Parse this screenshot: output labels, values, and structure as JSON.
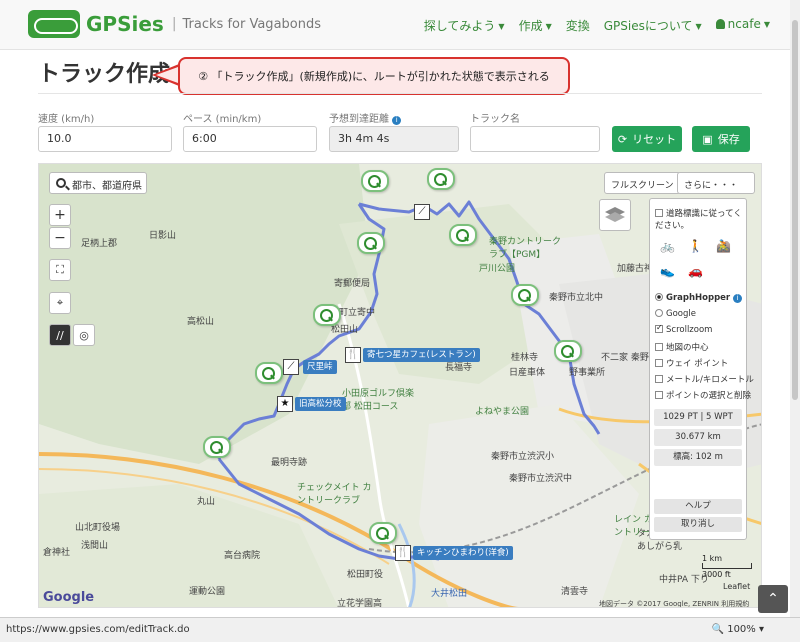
{
  "header": {
    "brand": "GPSies",
    "tagline": "Tracks for Vagabonds",
    "nav": [
      {
        "label": "探してみよう",
        "dropdown": true
      },
      {
        "label": "作成",
        "dropdown": true
      },
      {
        "label": "変換",
        "dropdown": false
      },
      {
        "label": "GPSiesについて",
        "dropdown": true
      },
      {
        "label": "ncafe",
        "dropdown": true
      }
    ]
  },
  "page": {
    "title": "トラック作成",
    "callout": "② 「トラック作成」(新規作成)に、ルートが引かれた状態で表示される"
  },
  "form": {
    "speed_label": "速度 (km/h)",
    "speed_value": "10.0",
    "pace_label": "ペース (min/km)",
    "pace_value": "6:00",
    "eta_label": "予想到達距離",
    "eta_value": "3h 4m 4s",
    "name_label": "トラック名",
    "name_value": "",
    "reset_label": "リセット",
    "save_label": "保存"
  },
  "map": {
    "search_placeholder": "都市、都道府県",
    "fullscreen": "フルスクリーン",
    "more": "さらに・・・",
    "zoom_in": "+",
    "zoom_out": "−",
    "labels": [
      {
        "text": "足柄上郡",
        "cls": ""
      },
      {
        "text": "日影山",
        "cls": ""
      },
      {
        "text": "寄郵便局",
        "cls": ""
      },
      {
        "text": "高松山",
        "cls": ""
      },
      {
        "text": "秦野カントリークラブ【PGM】",
        "cls": "green"
      },
      {
        "text": "戸川公園",
        "cls": "green"
      },
      {
        "text": "加藤古神社",
        "cls": ""
      },
      {
        "text": "秦野市立北中",
        "cls": ""
      },
      {
        "text": "桂林寺",
        "cls": ""
      },
      {
        "text": "不二家 秦野",
        "cls": ""
      },
      {
        "text": "日産車体",
        "cls": ""
      },
      {
        "text": "野事業所",
        "cls": ""
      },
      {
        "text": "小田原ゴルフ倶楽部 松田コース",
        "cls": "green"
      },
      {
        "text": "よねやま公園",
        "cls": "green"
      },
      {
        "text": "秦野市立渋沢小",
        "cls": ""
      },
      {
        "text": "秦野市立渋沢中",
        "cls": ""
      },
      {
        "text": "最明寺跡",
        "cls": ""
      },
      {
        "text": "チェックメイト カントリークラブ",
        "cls": "green"
      },
      {
        "text": "山北町役場",
        "cls": ""
      },
      {
        "text": "浅間山",
        "cls": ""
      },
      {
        "text": "丸山",
        "cls": ""
      },
      {
        "text": "倉神社",
        "cls": ""
      },
      {
        "text": "高台病院",
        "cls": ""
      },
      {
        "text": "運動公園",
        "cls": ""
      },
      {
        "text": "松田町役",
        "cls": ""
      },
      {
        "text": "立花学園高",
        "cls": ""
      },
      {
        "text": "タカナシ乳業 あしがら乳",
        "cls": ""
      },
      {
        "text": "清雲寺",
        "cls": ""
      },
      {
        "text": "レイン カントリー",
        "cls": "green"
      },
      {
        "text": "大井松田",
        "cls": "blue"
      },
      {
        "text": "中井PA 下り",
        "cls": ""
      },
      {
        "text": "町立寄中",
        "cls": ""
      },
      {
        "text": "松田山",
        "cls": ""
      },
      {
        "text": "長福寺",
        "cls": ""
      }
    ],
    "pois": [
      {
        "text": "寄七つ星カフェ(レストラン)",
        "icon": "restaurant-icon"
      },
      {
        "text": "尺里峠",
        "icon": "pass-icon"
      },
      {
        "text": "旧高松分校",
        "icon": "star-icon"
      },
      {
        "text": "キッチンひまわり(洋食)",
        "icon": "restaurant-icon"
      }
    ],
    "panel": {
      "follow_road": "道路標識に従ってください。",
      "router_graphhopper": "GraphHopper",
      "router_google": "Google",
      "scrollzoom": "Scrollzoom",
      "map_center": "地図の中心",
      "waypoint": "ウェイ ポイント",
      "mile_km": "メートル/キロメートル",
      "select_delete": "ポイントの選択と削除",
      "stat_points": "1029 PT | 5 WPT",
      "stat_distance": "30.677 km",
      "stat_elevation": "標高: 102 m",
      "help": "ヘルプ",
      "undo": "取り消し"
    },
    "scale": "3000 ft",
    "scale2": "1 km",
    "google": "Google",
    "leaflet": "Leaflet",
    "attribution": "地図データ ©2017 Google, ZENRIN  利用規約"
  },
  "status": {
    "url": "https://www.gpsies.com/editTrack.do",
    "zoom": "100%"
  },
  "colors": {
    "brand_green": "#3a9d3a",
    "button_green": "#25a35a",
    "route": "#6b7fd6",
    "callout_border": "#d8322e"
  }
}
